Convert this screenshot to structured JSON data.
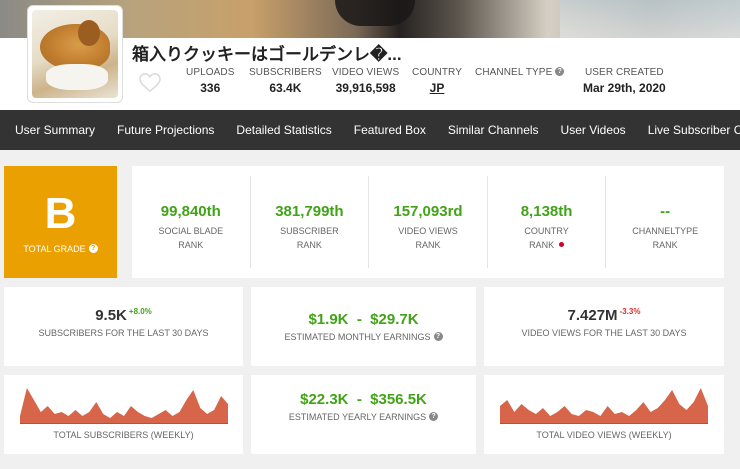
{
  "channel": {
    "name": "箱入りクッキーはゴールデンレ�...",
    "stats": [
      {
        "label": "UPLOADS",
        "value": "336"
      },
      {
        "label": "SUBSCRIBERS",
        "value": "63.4K"
      },
      {
        "label": "VIDEO VIEWS",
        "value": "39,916,598"
      },
      {
        "label": "COUNTRY",
        "value": "JP"
      },
      {
        "label": "CHANNEL TYPE",
        "value": ""
      },
      {
        "label": "USER CREATED",
        "value": "Mar 29th, 2020"
      }
    ]
  },
  "nav": [
    "User Summary",
    "Future Projections",
    "Detailed Statistics",
    "Featured Box",
    "Similar Channels",
    "User Videos",
    "Live Subscriber Co"
  ],
  "grade": {
    "letter": "B",
    "label": "TOTAL GRADE"
  },
  "ranks": [
    {
      "value": "99,840th",
      "line1": "SOCIAL BLADE",
      "line2": "RANK"
    },
    {
      "value": "381,799th",
      "line1": "SUBSCRIBER",
      "line2": "RANK"
    },
    {
      "value": "157,093rd",
      "line1": "VIDEO VIEWS",
      "line2": "RANK"
    },
    {
      "value": "8,138th",
      "line1": "COUNTRY",
      "line2": "RANK"
    },
    {
      "value": "--",
      "line1": "CHANNELTYPE",
      "line2": "RANK"
    }
  ],
  "cards": {
    "subs30": {
      "value": "9.5K",
      "change": "+8.0%",
      "label": "SUBSCRIBERS FOR THE LAST 30 DAYS"
    },
    "monthly": {
      "value": "$1.9K  -  $29.7K",
      "label": "ESTIMATED MONTHLY EARNINGS"
    },
    "views30": {
      "value": "7.427M",
      "change": "-3.3%",
      "label": "VIDEO VIEWS FOR THE LAST 30 DAYS"
    },
    "totalSubs": {
      "label": "TOTAL SUBSCRIBERS (WEEKLY)"
    },
    "yearly": {
      "value": "$22.3K  -  $356.5K",
      "label": "ESTIMATED YEARLY EARNINGS"
    },
    "totalViews": {
      "label": "TOTAL VIDEO VIEWS (WEEKLY)"
    }
  },
  "colors": {
    "grade": "#e9a000",
    "green": "#41a317",
    "red": "#d32f2f",
    "spark": "#d6654a"
  },
  "sparks": {
    "subs": [
      0.2,
      0.9,
      0.6,
      0.3,
      0.45,
      0.25,
      0.3,
      0.2,
      0.35,
      0.2,
      0.3,
      0.55,
      0.25,
      0.15,
      0.3,
      0.2,
      0.45,
      0.3,
      0.2,
      0.15,
      0.25,
      0.35,
      0.2,
      0.3,
      0.6,
      0.85,
      0.4,
      0.25,
      0.35,
      0.7,
      0.5
    ],
    "views": [
      0.45,
      0.6,
      0.3,
      0.5,
      0.35,
      0.25,
      0.4,
      0.2,
      0.3,
      0.45,
      0.25,
      0.2,
      0.35,
      0.3,
      0.2,
      0.45,
      0.25,
      0.3,
      0.2,
      0.35,
      0.55,
      0.3,
      0.4,
      0.6,
      0.85,
      0.5,
      0.35,
      0.55,
      0.9,
      0.45
    ]
  }
}
